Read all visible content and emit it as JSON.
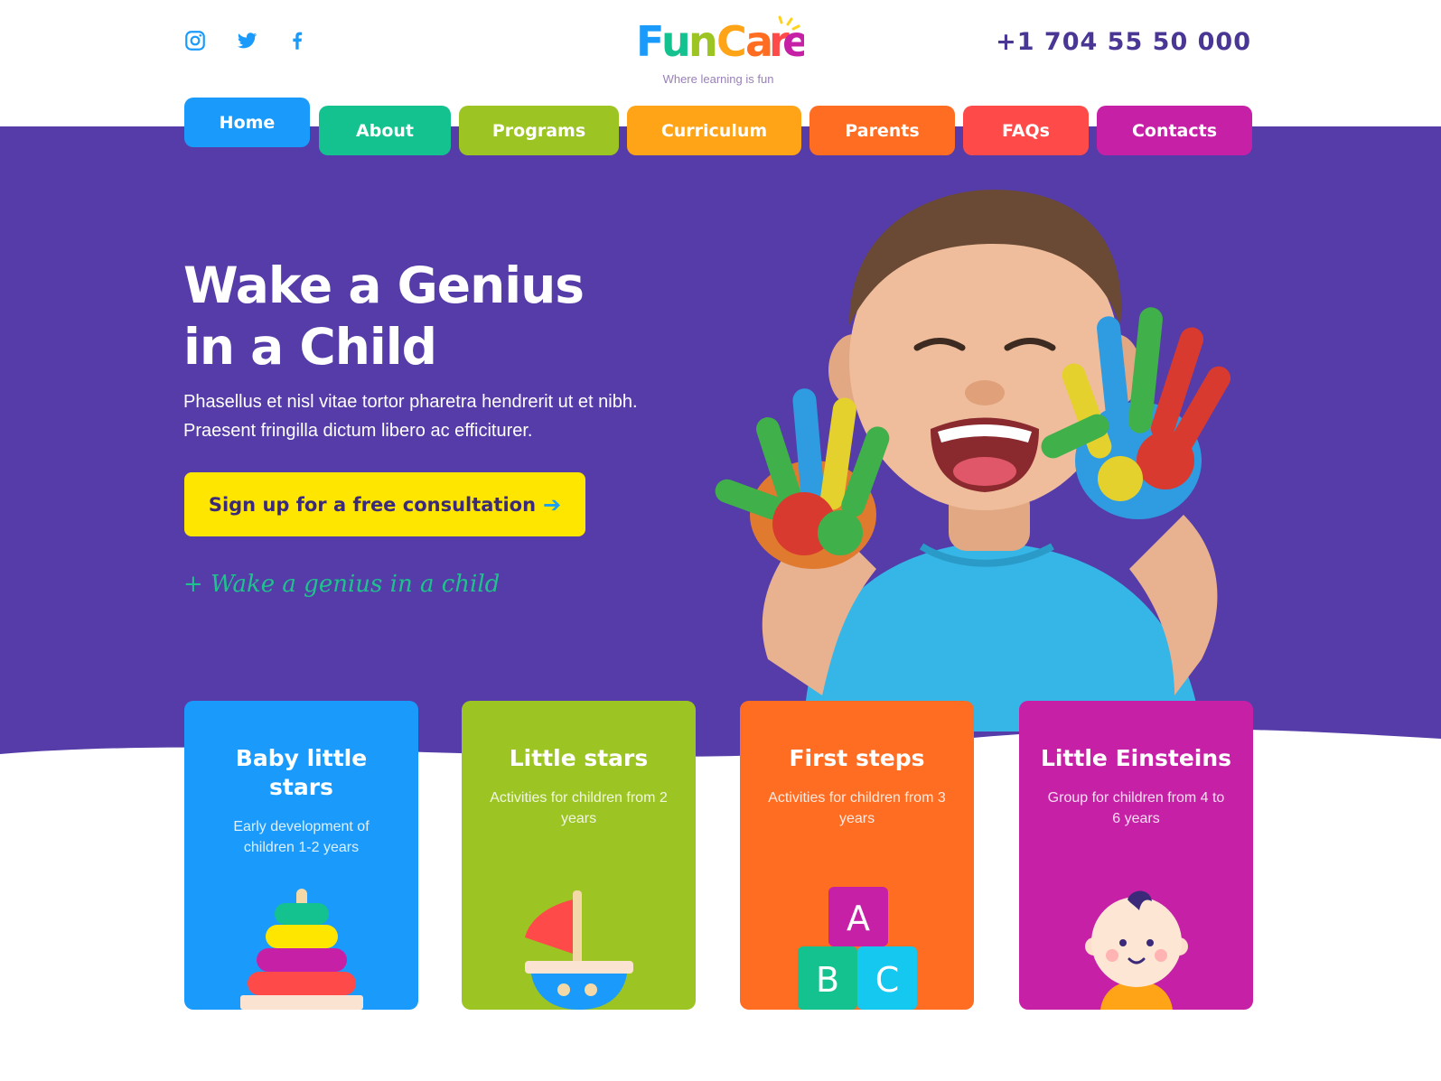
{
  "header": {
    "social": [
      "instagram-icon",
      "twitter-icon",
      "facebook-icon"
    ],
    "logo": {
      "text": "FunCare",
      "tagline": "Where learning is fun"
    },
    "phone": "+1 704 55 50 000"
  },
  "nav": {
    "items": [
      {
        "label": "Home",
        "color": "#1a9bfc"
      },
      {
        "label": "About",
        "color": "#14c28f"
      },
      {
        "label": "Programs",
        "color": "#9cc524"
      },
      {
        "label": "Curriculum",
        "color": "#ffa317"
      },
      {
        "label": "Parents",
        "color": "#ff6d22"
      },
      {
        "label": "FAQs",
        "color": "#ff4a4a"
      },
      {
        "label": "Contacts",
        "color": "#c620a6"
      }
    ],
    "active": "Home"
  },
  "hero": {
    "title_line1": "Wake a Genius",
    "title_line2": "in a Child",
    "text_line1": "Phasellus et nisl vitae tortor pharetra hendrerit ut et nibh.",
    "text_line2": "Praesent fringilla dictum libero ac efficiturer.",
    "cta_label": "Sign up for a free consultation",
    "cta_arrow": "➔",
    "script_text": "+ Wake a genius in a child",
    "background": "#553ca8"
  },
  "cards": [
    {
      "title": "Baby little stars",
      "desc": "Early development of children 1-2 years",
      "color": "#1a9bfc",
      "icon": "stacking-rings-icon"
    },
    {
      "title": "Little stars",
      "desc": "Activities for children from 2 years",
      "color": "#9cc524",
      "icon": "toy-boat-icon"
    },
    {
      "title": "First steps",
      "desc": "Activities for children from 3 years",
      "color": "#ff6d22",
      "icon": "abc-blocks-icon"
    },
    {
      "title": "Little Einsteins",
      "desc": "Group for children from 4 to 6 years",
      "color": "#c620a6",
      "icon": "baby-face-icon"
    }
  ],
  "blocks": {
    "a": "A",
    "b": "B",
    "c": "C"
  }
}
